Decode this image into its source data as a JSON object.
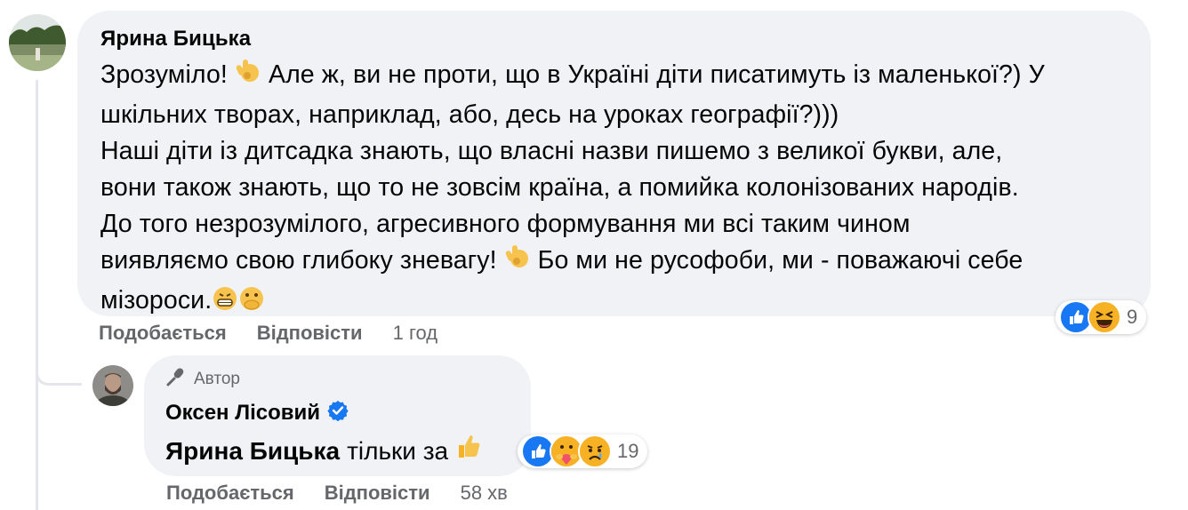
{
  "comment": {
    "author": "Ярина Бицька",
    "paragraphs": [
      {
        "parts": [
          "Зрозуміло! ",
          "ok-hand-emoji",
          " Але ж, ви не проти, що в Україні діти писатимуть із маленької?) У шкільних творах, наприклад, або, десь на уроках географії?)))"
        ]
      },
      {
        "parts": [
          "Наші діти із дитсадка знають, що власні назви пишемо з великої букви, але, вони також знають, що то не зовсім країна, а помийка колонізованих народів. До того незрозумілого, агресивного формування ми всі таким чином виявляємо свою глибоку зневагу! ",
          "ok-hand-emoji",
          " Бо ми не русофоби, ми - поважаючі себе мізороси.",
          "grin-emoji",
          "hand-over-mouth-emoji"
        ]
      }
    ],
    "line_texts": {
      "l1a": "Зрозуміло! ",
      "l1b": " Але ж, ви не проти, що в Україні діти писатимуть із маленької?) У",
      "l2": "шкільних творах, наприклад, або, десь на уроках географії?)))",
      "l3": "Наші діти із дитсадка знають, що власні назви пишемо з великої букви, але,",
      "l4": "вони також знають, що то не зовсім країна, а помийка колонізованих народів.",
      "l5": "До того незрозумілого, агресивного формування ми всі таким чином",
      "l6a": "виявляємо свою глибоку зневагу! ",
      "l6b": " Бо ми не русофоби, ми - поважаючі себе",
      "l7": "мізороси."
    },
    "actions": {
      "like": "Подобається",
      "reply": "Відповісти",
      "time": "1 год"
    },
    "reactions": {
      "icons": [
        "like-icon",
        "haha-icon"
      ],
      "count": "9"
    }
  },
  "reply": {
    "badge": "Автор",
    "author": "Оксен Лісовий",
    "verified": true,
    "mention": "Ярина Бицька",
    "text": "тільки за",
    "emoji": "thumbs-up-emoji",
    "actions": {
      "like": "Подобається",
      "reply": "Відповісти",
      "time": "58 хв"
    },
    "reactions": {
      "icons": [
        "like-icon",
        "care-icon",
        "sad-icon"
      ],
      "count": "19"
    }
  },
  "colors": {
    "bubble": "#f0f2f5",
    "secondary_text": "#65676b",
    "like_blue": "#1877f2",
    "verified_blue": "#1877f2",
    "reaction_yellow": "#f7b125"
  }
}
